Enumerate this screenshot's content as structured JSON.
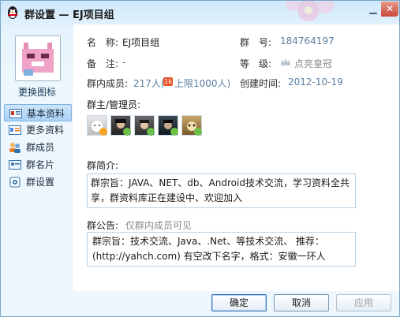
{
  "window": {
    "title": "群设置 — EJ项目组"
  },
  "sidebar": {
    "change_avatar": "更换图标",
    "items": [
      {
        "label": "基本资料",
        "active": true
      },
      {
        "label": "更多资料",
        "active": false
      },
      {
        "label": "群成员",
        "active": false
      },
      {
        "label": "群名片",
        "active": false
      },
      {
        "label": "群设置",
        "active": false
      }
    ]
  },
  "info": {
    "name_label": "名　称:",
    "name_value": "EJ项目组",
    "id_label": "群　号:",
    "id_value": "184764197",
    "remark_label": "备　注:",
    "remark_value": "-",
    "level_label": "等　级:",
    "level_value": "点亮皇冠",
    "members_label": "群内成员:",
    "members_value": "217人(",
    "members_limit": "上限1000人)",
    "members_badge": "1k",
    "created_label": "创建时间:",
    "created_value": "2012-10-19"
  },
  "admins": {
    "label": "群主/管理员:"
  },
  "intro": {
    "label": "群简介:",
    "text": "群宗旨：JAVA、NET、db、Android技术交流，学习资料全共享，群资料库正在建设中、欢迎加入"
  },
  "notice": {
    "label": "群公告:",
    "hint": "仅群内成员可见",
    "text": "群宗旨：技术交流、Java、.Net、等技术交流、  推荐：(http://yahch.com)  有空改下名字，格式：安徽一环人"
  },
  "buttons": {
    "ok": "确定",
    "cancel": "取消",
    "apply": "应用"
  },
  "colors": {
    "accent": "#3f79b4",
    "link": "#5a7ea0",
    "badge": "#e8552b"
  }
}
